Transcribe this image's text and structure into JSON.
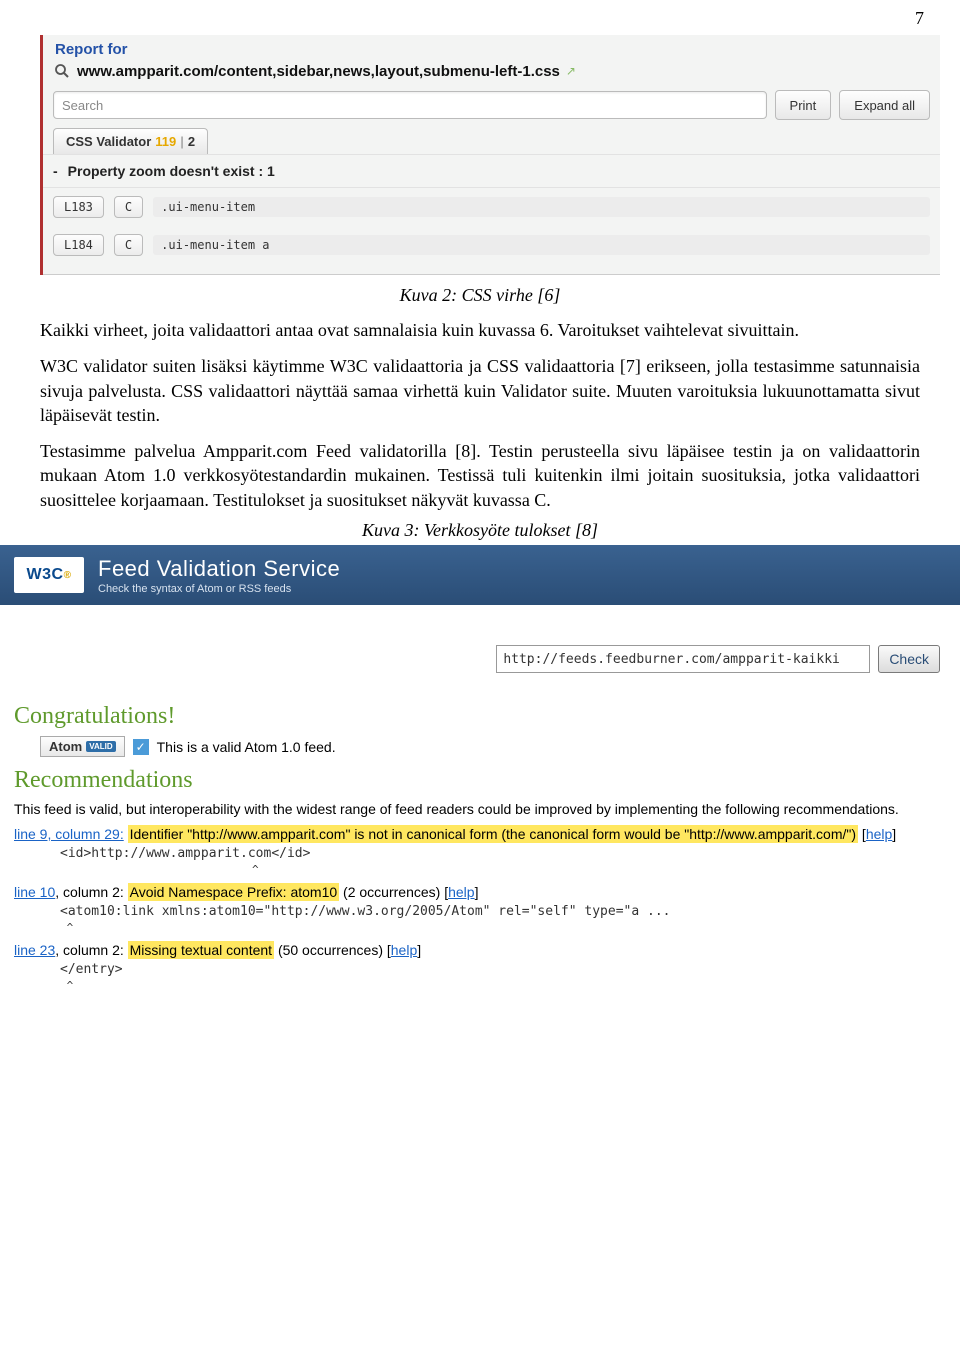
{
  "pageNumber": "7",
  "devtool": {
    "reportFor": "Report for",
    "url": "www.ampparit.com/content,sidebar,news,layout,submenu-left-1.css",
    "searchPlaceholder": "Search",
    "printBtn": "Print",
    "expandBtn": "Expand all",
    "tab": {
      "label": "CSS Validator",
      "warn": "119",
      "pipe": "|",
      "tail": "2"
    },
    "propRow": {
      "dash": "-",
      "text": "Property zoom doesn't exist : 1"
    },
    "rows": [
      {
        "line": "L183",
        "col": "C",
        "sel": ".ui-menu-item"
      },
      {
        "line": "L184",
        "col": "C",
        "sel": ".ui-menu-item a"
      }
    ]
  },
  "caption1": "Kuva 2: CSS virhe [6]",
  "p1": "Kaikki virheet, joita validaattori antaa ovat samnalaisia kuin kuvassa 6. Varoitukset vaihtelevat sivuittain.",
  "p2": "W3C validator suiten lisäksi käytimme W3C validaattoria ja CSS validaattoria [7] erikseen, jolla testasimme satunnaisia sivuja palvelusta. CSS validaattori näyttää samaa virhettä kuin Validator suite. Muuten varoituksia lukuunottamatta sivut läpäisevät testin.",
  "p3": "Testasimme palvelua Ampparit.com Feed validatorilla [8]. Testin perusteella sivu läpäisee testin ja on validaattorin mukaan Atom 1.0 verkkosyötestandardin mukainen. Testissä tuli kuitenkin ilmi joitain suosituksia, jotka validaattori suosittelee korjaamaan. Testitulokset ja suositukset näkyvät kuvassa C.",
  "caption2": "Kuva 3: Verkkosyöte tulokset [8]",
  "w3c": {
    "logo": "W3C",
    "title": "Feed Validation Service",
    "subtitle": "Check the syntax of Atom or RSS feeds",
    "feedUrl": "http://feeds.feedburner.com/ampparit-kaikki",
    "checkBtn": "Check",
    "congrats": "Congratulations!",
    "atomLabel": "Atom",
    "validBadge": "VALID",
    "validText": "This is a valid Atom 1.0 feed.",
    "recsHeading": "Recommendations",
    "recIntro": "This feed is valid, but interoperability with the widest range of feed readers could be improved by implementing the following recommendations.",
    "help": "help",
    "rec1": {
      "link": "line 9, column 29:",
      "hl": "Identifier \"http://www.ampparit.com\" is not in canonical form (the canonical form would be \"http://www.ampparit.com/\")",
      "code": "<id>http://www.ampparit.com</id>"
    },
    "rec2": {
      "link": "line 10",
      "mid": ", column 2:",
      "hl": "Avoid Namespace Prefix: atom10",
      "tail": " (2 occurrences) ",
      "code": "<atom10:link xmlns:atom10=\"http://www.w3.org/2005/Atom\" rel=\"self\" type=\"a ..."
    },
    "rec3": {
      "link": "line 23",
      "mid": ", column 2:",
      "hl": "Missing textual content",
      "tail": " (50 occurrences) ",
      "code": "</entry>"
    }
  }
}
